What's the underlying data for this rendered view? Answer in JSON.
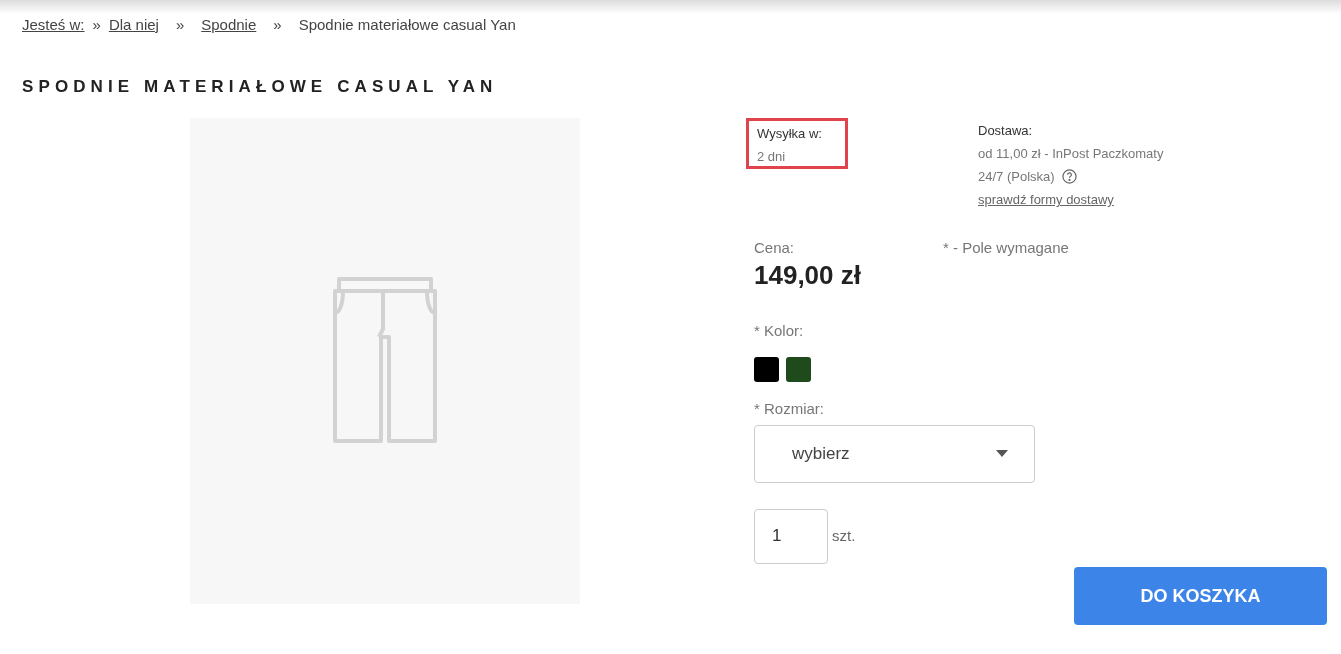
{
  "breadcrumb": {
    "label": "Jesteś w:",
    "separator": "»",
    "items": [
      {
        "text": "Dla niej",
        "link": true
      },
      {
        "text": "Spodnie",
        "link": true
      },
      {
        "text": "Spodnie materiałowe casual Yan",
        "link": false
      }
    ]
  },
  "title": "SPODNIE MATERIAŁOWE CASUAL YAN",
  "image": {
    "kind": "placeholder"
  },
  "shipping": {
    "label": "Wysyłka w:",
    "value": "2 dni",
    "highlighted": true
  },
  "delivery": {
    "label": "Dostawa:",
    "lines": [
      "od 11,00 zł - InPost Paczkomaty",
      "24/7 (Polska)"
    ],
    "help_icon": true,
    "link": "sprawdź formy dostawy"
  },
  "price": {
    "label": "Cena:",
    "value": "149,00 zł"
  },
  "required_note": "* - Pole wymagane",
  "color_label": "* Kolor:",
  "colors": [
    {
      "color": "#000000"
    },
    {
      "color": "#1f4a1c"
    }
  ],
  "size_label": "* Rozmiar:",
  "size_select": {
    "value": "wybierz"
  },
  "quantity": {
    "value": "1",
    "unit": "szt."
  },
  "cart_button": "DO KOSZYKA"
}
